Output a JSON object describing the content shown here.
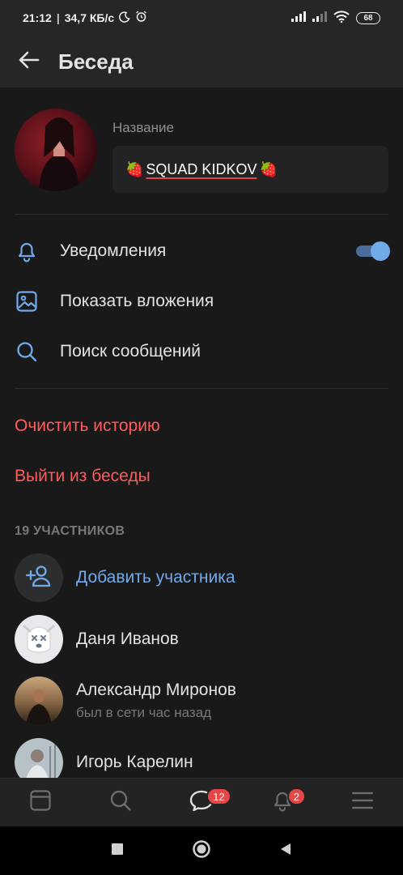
{
  "status_bar": {
    "time": "21:12",
    "speed": "34,7 КБ/с",
    "battery": "68",
    "icons": [
      "moon-icon",
      "alarm-icon",
      "signal-icon",
      "signal-icon",
      "wifi-icon",
      "battery-icon"
    ]
  },
  "app_bar": {
    "title": "Беседа",
    "back_icon": "arrow-back-icon"
  },
  "chat": {
    "name_label": "Название",
    "name_emoji": "🍓",
    "name_value": "SQUAD KIDKOV"
  },
  "menu": {
    "notifications_label": "Уведомления",
    "notifications_enabled": true,
    "attachments_label": "Показать вложения",
    "search_label": "Поиск сообщений"
  },
  "actions": {
    "clear_history": "Очистить историю",
    "leave_chat": "Выйти из беседы"
  },
  "members": {
    "header": "19 УЧАСТНИКОВ",
    "add_label": "Добавить участника",
    "list": [
      {
        "name": "Даня Иванов",
        "status": ""
      },
      {
        "name": "Александр Миронов",
        "status": "был в сети час назад"
      },
      {
        "name": "Игорь Карелин",
        "status": ""
      }
    ]
  },
  "tab_bar": {
    "tabs": [
      "news-icon",
      "search-icon",
      "messages-icon",
      "notifications-icon",
      "menu-icon"
    ],
    "messages_badge": "12",
    "notifications_badge": "2"
  },
  "colors": {
    "accent": "#71aaeb",
    "danger": "#ff5c5c",
    "background": "#19191a",
    "bar": "#262627",
    "badge": "#e64646"
  }
}
